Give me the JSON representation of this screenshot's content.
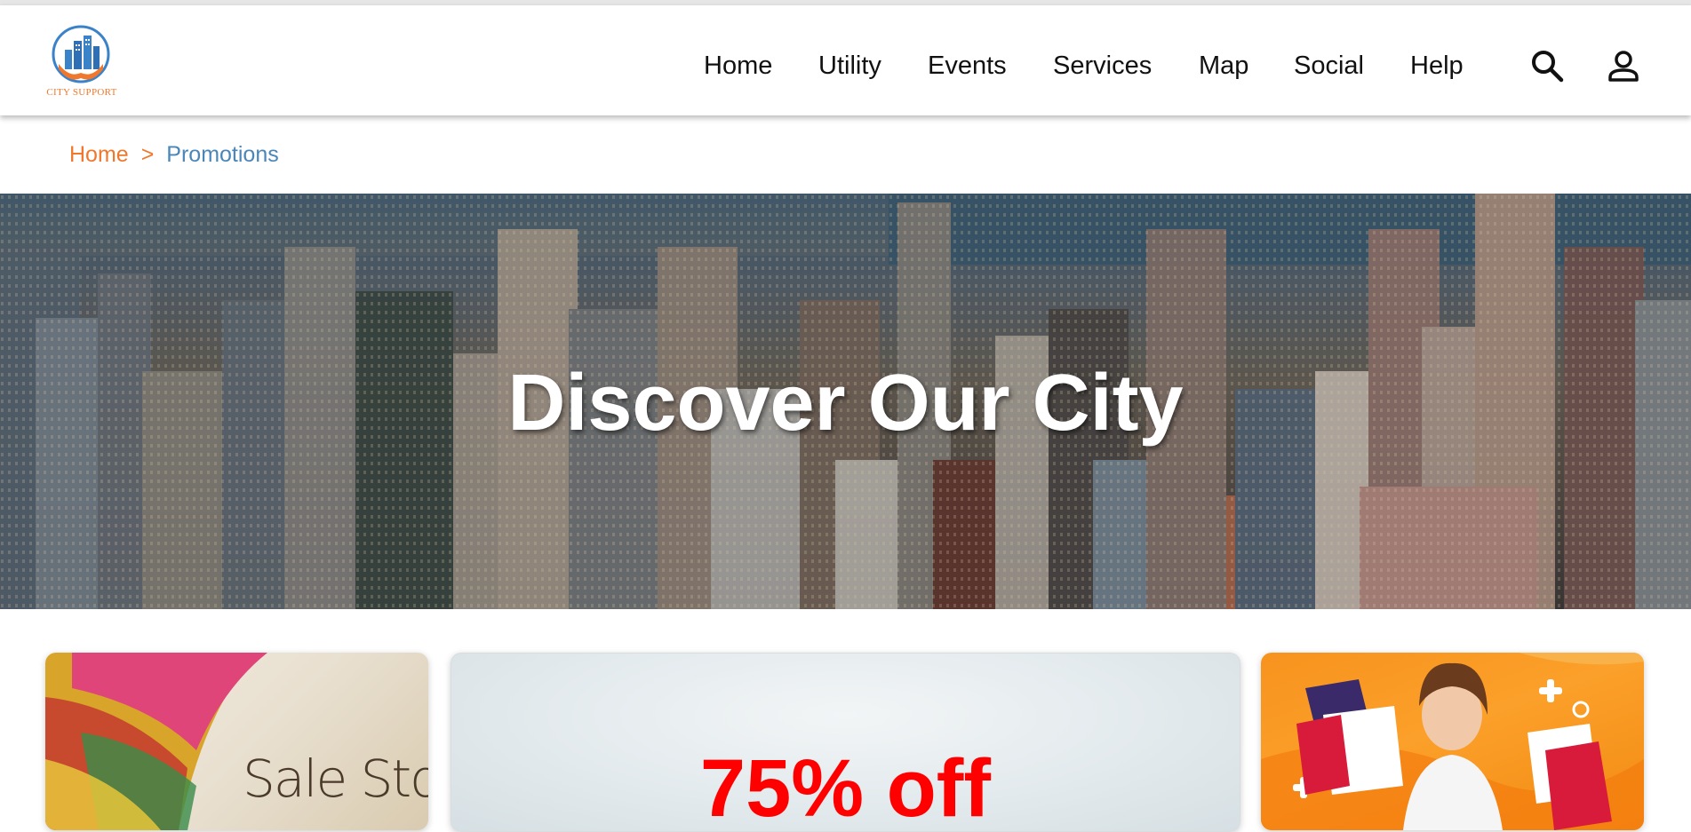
{
  "brand": {
    "name": "CITY SUPPORT",
    "accent": "#f0782d",
    "link_blue": "#4a86b8"
  },
  "nav": {
    "items": [
      "Home",
      "Utility",
      "Events",
      "Services",
      "Map",
      "Social",
      "Help"
    ]
  },
  "header_icons": [
    "search-icon",
    "user-icon"
  ],
  "breadcrumb": {
    "home": "Home",
    "separator": ">",
    "current": "Promotions"
  },
  "hero": {
    "title": "Discover Our City"
  },
  "promotions": [
    {
      "text": "Sale Storm"
    },
    {
      "text": "75% off",
      "color": "#ff0000"
    },
    {
      "text": ""
    }
  ]
}
